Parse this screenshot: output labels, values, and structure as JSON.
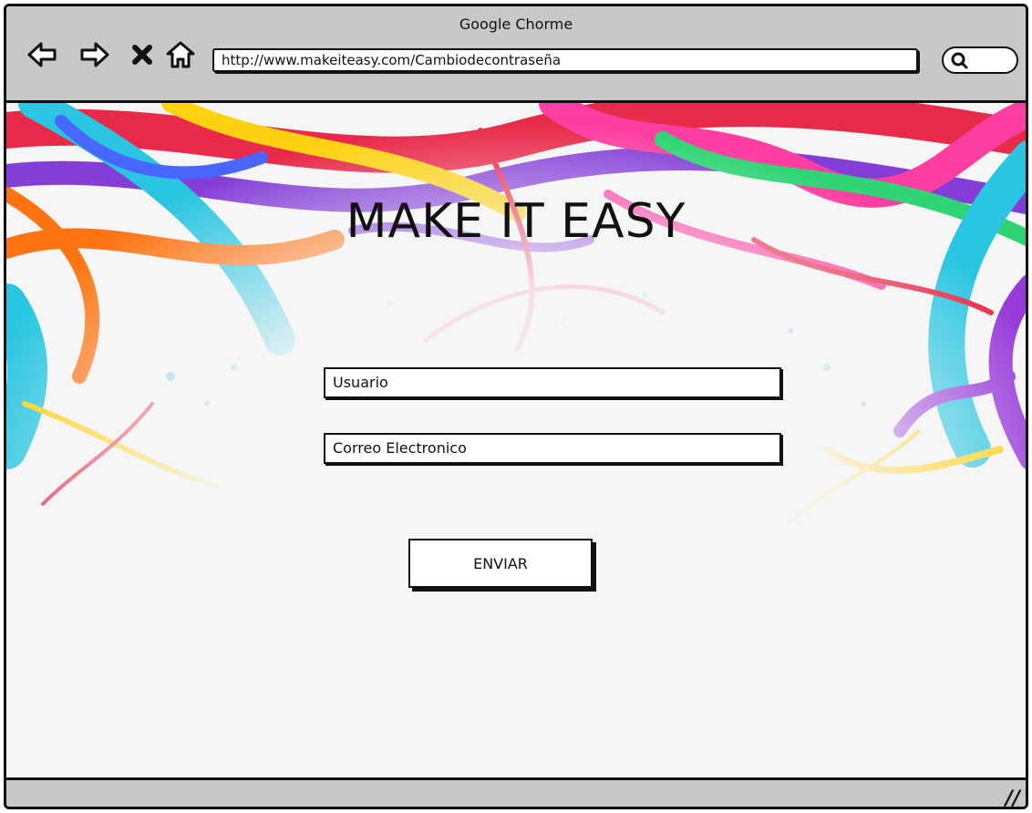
{
  "window": {
    "title": "Google Chorme"
  },
  "toolbar": {
    "back_icon": "arrow-left-icon",
    "forward_icon": "arrow-right-icon",
    "stop_icon": "close-icon",
    "home_icon": "home-icon",
    "url": "http://www.makeiteasy.com/Cambiodecontraseña",
    "search_icon": "search-icon"
  },
  "page": {
    "brand": "MAKE IT EASY",
    "username_field": "Usuario",
    "email_field": "Correo Electronico",
    "submit_label": "ENVIAR"
  },
  "statusbar": {
    "grip_icon": "resize-grip-icon"
  }
}
